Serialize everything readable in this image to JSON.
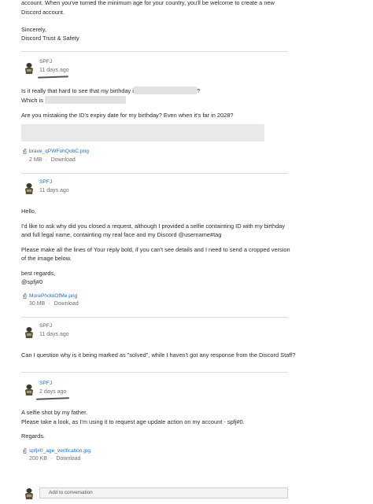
{
  "top_message": {
    "line1": "account. When you've turned the minimum age for your country, you'll be welcome to create a new",
    "line2": "Discord account.",
    "sign1": "Sincerely,",
    "sign2": "Discord Trust & Safety"
  },
  "messages": [
    {
      "author": "SPFJ",
      "time": "11 days ago",
      "lines": [
        "Is it really that hard to see that my birthday is",
        "?",
        "Which is",
        "Are you mistaking the ID's expiry date for my birthday? Even when it's far in 2028?"
      ],
      "attachment": {
        "name": "brave_qPWFohQobC.png",
        "size": "2 MB",
        "download": "Download"
      }
    },
    {
      "author": "SPFJ",
      "time": "11 days ago",
      "lines": [
        "Hello,",
        "I'd like to ask why did you closed a request, although I provided a selfie containting ID with my birthday",
        "and full legal name, containting my real face and my Discord @username#tag",
        "Please make all the lines of Your reply bold, if you can't see details and I need to send a cropped version",
        "of the image below.",
        "best regards,",
        "@spfj#0"
      ],
      "attachment": {
        "name": "MorePhotoOfMe.png",
        "size": "30 MB",
        "download": "Download"
      }
    },
    {
      "author": "SPFJ",
      "time": "11 days ago",
      "lines": [
        "Can I question why is it being marked as \"solved\", while I haven't got any response from the Discord Staff?"
      ]
    },
    {
      "author": "SPFJ",
      "time": "2 days ago",
      "lines": [
        "A selfie shot by my father.",
        "Please take a look, as I'm using it to request age update action on my account - spfj#0.",
        "Regards."
      ],
      "attachment": {
        "name": "spfj#0_age_verification.jpg",
        "size": "200 KB",
        "download": "Download"
      }
    }
  ],
  "reply": {
    "placeholder": "Add to conversation"
  },
  "colors": {
    "link": "#1a6fc8",
    "muted": "#707070",
    "divider": "#dcdcdc",
    "redaction": "#e2e2e2"
  },
  "icons": {
    "avatar": "avatar-figure-icon",
    "attachment": "paperclip-icon"
  }
}
